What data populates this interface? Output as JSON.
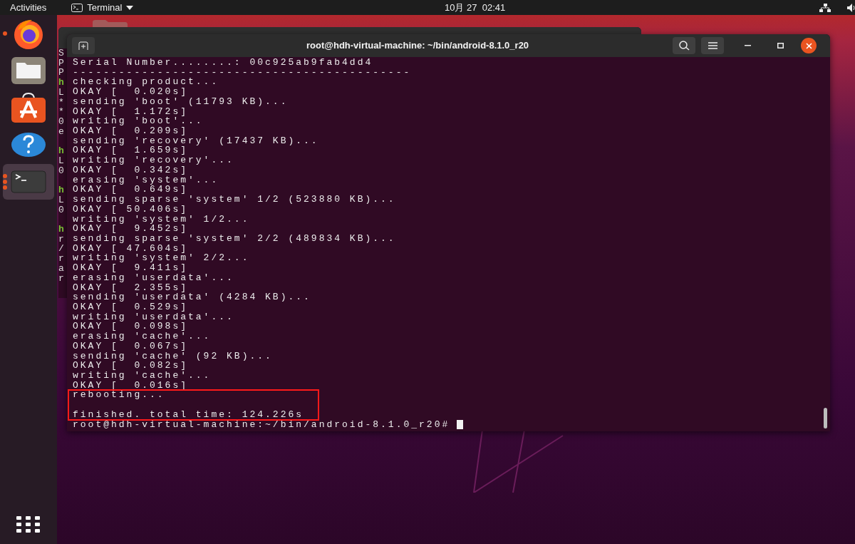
{
  "top_bar": {
    "activities": "Activities",
    "app_menu": "Terminal",
    "clock": "10月 27  02:41"
  },
  "dock": {
    "items": [
      {
        "kind": "firefox",
        "running": true,
        "multiple": false,
        "selected": false
      },
      {
        "kind": "files",
        "running": false,
        "selected": false
      },
      {
        "kind": "software",
        "running": false,
        "selected": false
      },
      {
        "kind": "help",
        "running": false,
        "selected": false
      },
      {
        "kind": "terminal",
        "running": true,
        "multiple": true,
        "selected": true
      }
    ]
  },
  "background_window": {
    "line_starts": [
      {
        "kind": "output",
        "text": "S"
      },
      {
        "kind": "output",
        "text": "P"
      },
      {
        "kind": "output",
        "text": "P"
      },
      {
        "kind": "prompt",
        "text": "h"
      },
      {
        "kind": "output",
        "text": "L"
      },
      {
        "kind": "output",
        "text": "*"
      },
      {
        "kind": "output",
        "text": "*"
      },
      {
        "kind": "output",
        "text": "0"
      },
      {
        "kind": "output",
        "text": "e"
      },
      {
        "kind": "blank"
      },
      {
        "kind": "prompt",
        "text": "h"
      },
      {
        "kind": "output",
        "text": "L"
      },
      {
        "kind": "output",
        "text": "0"
      },
      {
        "kind": "blank"
      },
      {
        "kind": "prompt",
        "text": "h"
      },
      {
        "kind": "output",
        "text": "L"
      },
      {
        "kind": "output",
        "text": "0"
      },
      {
        "kind": "blank"
      },
      {
        "kind": "prompt",
        "text": "h"
      },
      {
        "kind": "output",
        "text": "r"
      },
      {
        "kind": "output",
        "text": "/"
      },
      {
        "kind": "output",
        "text": "r"
      },
      {
        "kind": "output",
        "text": "a"
      },
      {
        "kind": "output",
        "text": "r"
      }
    ]
  },
  "terminal": {
    "title": "root@hdh-virtual-machine: ~/bin/android-8.1.0_r20",
    "lines": [
      {
        "kind": "output",
        "text": "Serial Number........: 00c925ab9fab4dd4",
        "highlighted": false
      },
      {
        "kind": "output",
        "text": "--------------------------------------------",
        "highlighted": false
      },
      {
        "kind": "output",
        "text": "checking product...",
        "highlighted": false
      },
      {
        "kind": "output",
        "text": "OKAY [  0.020s]",
        "highlighted": false
      },
      {
        "kind": "output",
        "text": "sending 'boot' (11793 KB)...",
        "highlighted": false
      },
      {
        "kind": "output",
        "text": "OKAY [  1.172s]",
        "highlighted": false
      },
      {
        "kind": "output",
        "text": "writing 'boot'...",
        "highlighted": false
      },
      {
        "kind": "output",
        "text": "OKAY [  0.209s]",
        "highlighted": false
      },
      {
        "kind": "output",
        "text": "sending 'recovery' (17437 KB)...",
        "highlighted": false
      },
      {
        "kind": "output",
        "text": "OKAY [  1.659s]",
        "highlighted": false
      },
      {
        "kind": "output",
        "text": "writing 'recovery'...",
        "highlighted": false
      },
      {
        "kind": "output",
        "text": "OKAY [  0.342s]",
        "highlighted": false
      },
      {
        "kind": "output",
        "text": "erasing 'system'...",
        "highlighted": false
      },
      {
        "kind": "output",
        "text": "OKAY [  0.649s]",
        "highlighted": false
      },
      {
        "kind": "output",
        "text": "sending sparse 'system' 1/2 (523880 KB)...",
        "highlighted": false
      },
      {
        "kind": "output",
        "text": "OKAY [ 50.406s]",
        "highlighted": false
      },
      {
        "kind": "output",
        "text": "writing 'system' 1/2...",
        "highlighted": false
      },
      {
        "kind": "output",
        "text": "OKAY [  9.452s]",
        "highlighted": false
      },
      {
        "kind": "output",
        "text": "sending sparse 'system' 2/2 (489834 KB)...",
        "highlighted": false
      },
      {
        "kind": "output",
        "text": "OKAY [ 47.604s]",
        "highlighted": false
      },
      {
        "kind": "output",
        "text": "writing 'system' 2/2...",
        "highlighted": false
      },
      {
        "kind": "output",
        "text": "OKAY [  9.411s]",
        "highlighted": false
      },
      {
        "kind": "output",
        "text": "erasing 'userdata'...",
        "highlighted": false
      },
      {
        "kind": "output",
        "text": "OKAY [  2.355s]",
        "highlighted": false
      },
      {
        "kind": "output",
        "text": "sending 'userdata' (4284 KB)...",
        "highlighted": false
      },
      {
        "kind": "output",
        "text": "OKAY [  0.529s]",
        "highlighted": false
      },
      {
        "kind": "output",
        "text": "writing 'userdata'...",
        "highlighted": false
      },
      {
        "kind": "output",
        "text": "OKAY [  0.098s]",
        "highlighted": false
      },
      {
        "kind": "output",
        "text": "erasing 'cache'...",
        "highlighted": false
      },
      {
        "kind": "output",
        "text": "OKAY [  0.067s]",
        "highlighted": false
      },
      {
        "kind": "output",
        "text": "sending 'cache' (92 KB)...",
        "highlighted": false
      },
      {
        "kind": "output",
        "text": "OKAY [  0.082s]",
        "highlighted": false
      },
      {
        "kind": "output",
        "text": "writing 'cache'...",
        "highlighted": false
      },
      {
        "kind": "output",
        "text": "OKAY [  0.016s]",
        "highlighted": false
      },
      {
        "kind": "output",
        "text": "rebooting...",
        "highlighted": true
      },
      {
        "kind": "blank",
        "highlighted": true
      },
      {
        "kind": "output",
        "text": "finished. total time: 124.226s",
        "highlighted": true
      },
      {
        "kind": "prompt",
        "text": "root@hdh-virtual-machine:~/bin/android-8.1.0_r20#",
        "highlighted": false
      }
    ]
  }
}
